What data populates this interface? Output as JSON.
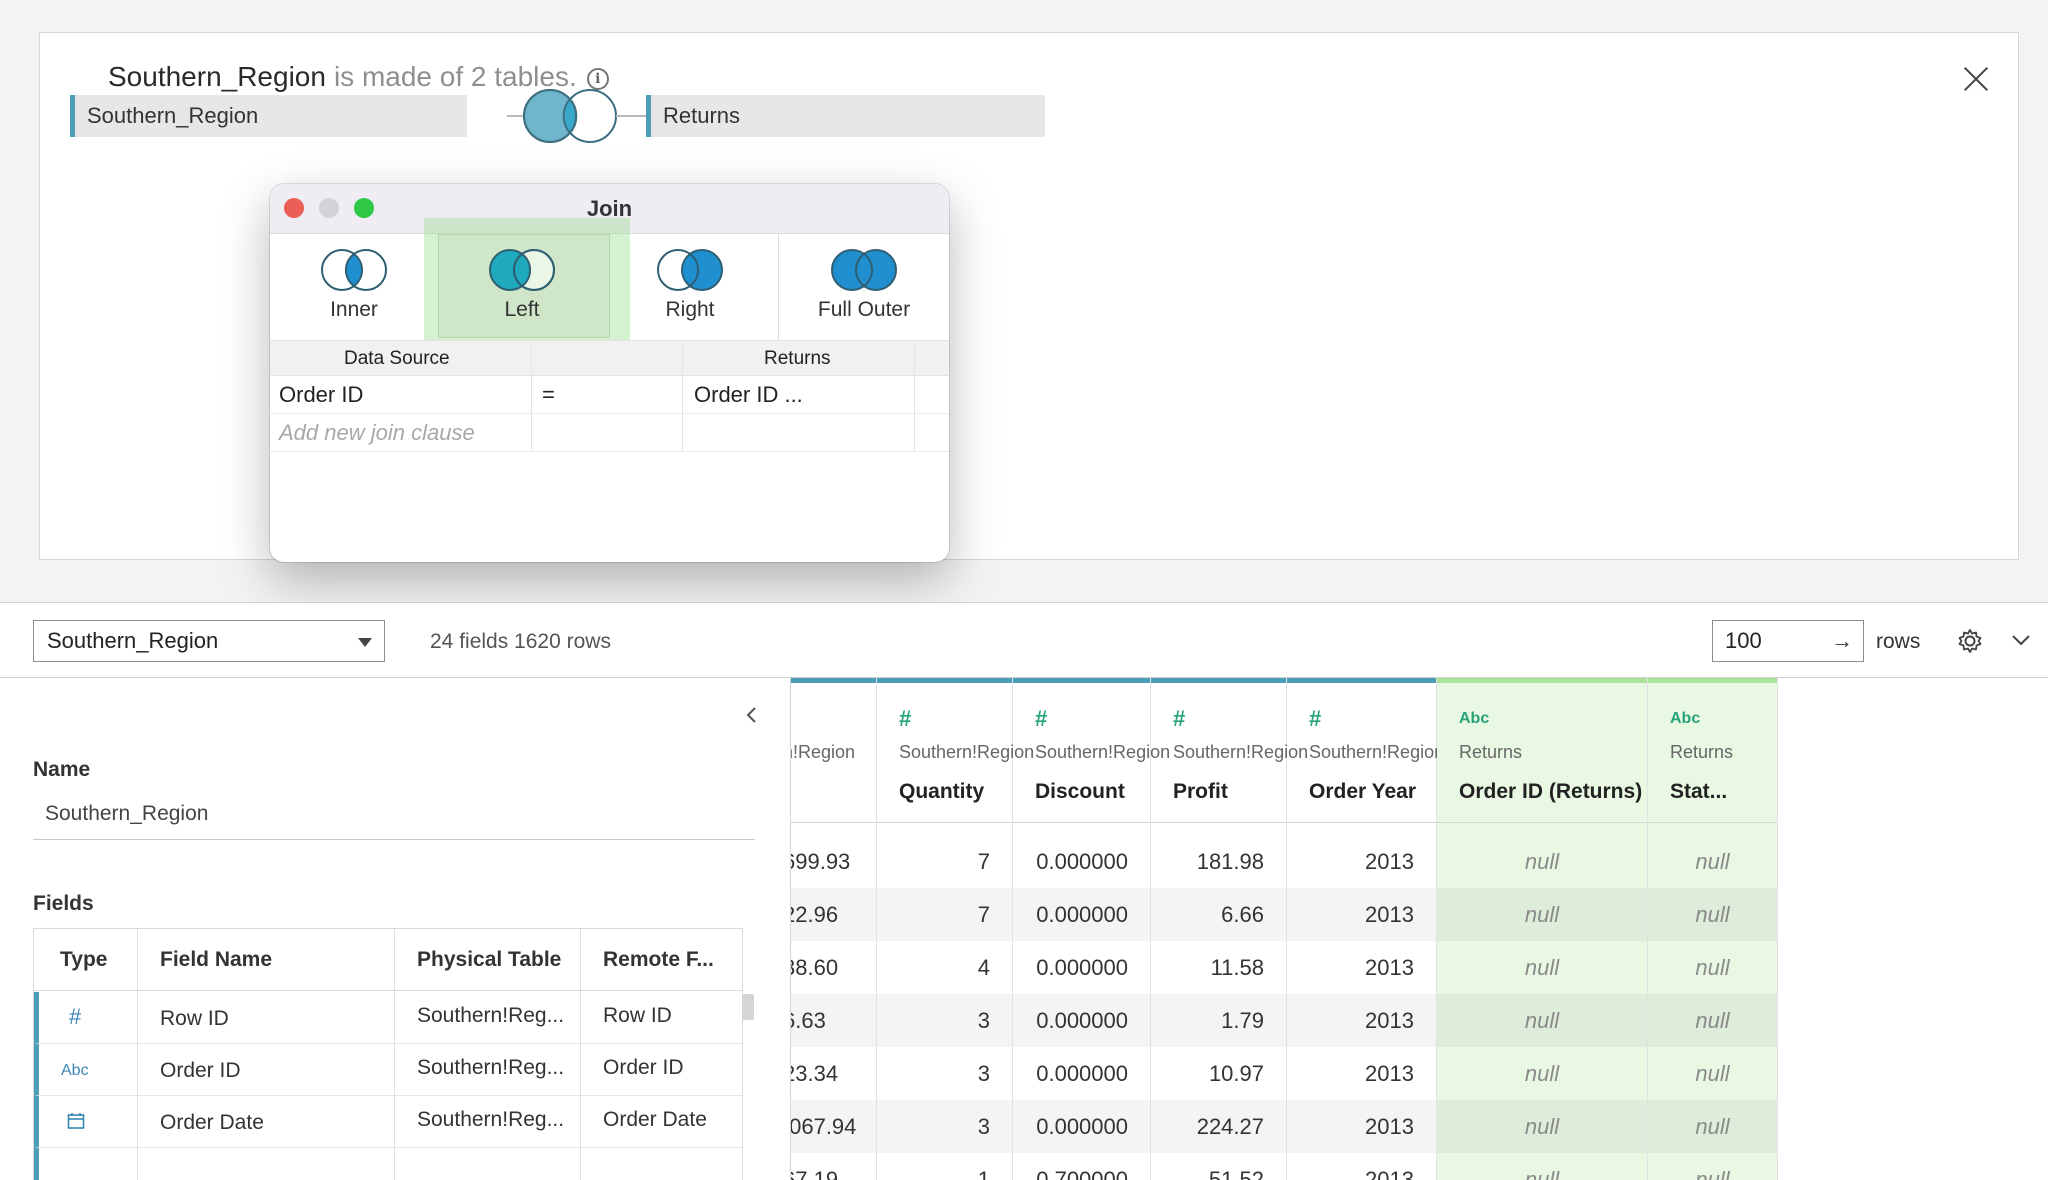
{
  "canvas": {
    "source_name": "Southern_Region",
    "source_subtitle": "is made of 2 tables.",
    "left_table": "Southern_Region",
    "right_table": "Returns"
  },
  "dialog": {
    "title": "Join",
    "types": [
      "Inner",
      "Left",
      "Right",
      "Full Outer"
    ],
    "selected_type": "Left",
    "headers": {
      "left": "Data Source",
      "right": "Returns"
    },
    "clause": {
      "left": "Order ID",
      "op": "=",
      "right": "Order ID ..."
    },
    "add_clause_placeholder": "Add new join clause"
  },
  "toolbar": {
    "source_select": "Southern_Region",
    "field_count": "24 fields 1620 rows",
    "rows_value": "100",
    "rows_arrow": "→",
    "rows_label": "rows"
  },
  "metadata": {
    "name_label": "Name",
    "name_value": "Southern_Region",
    "fields_label": "Fields",
    "columns": [
      "Type",
      "Field Name",
      "Physical Table",
      "Remote F..."
    ],
    "rows": [
      {
        "type_icon": "#",
        "field": "Row ID",
        "table": "Southern!Reg...",
        "remote": "Row ID"
      },
      {
        "type_icon": "Abc",
        "field": "Order ID",
        "table": "Southern!Reg...",
        "remote": "Order ID"
      },
      {
        "type_icon": "calendar-icon",
        "field": "Order Date",
        "table": "Southern!Reg...",
        "remote": "Order Date"
      }
    ]
  },
  "grid": {
    "columns": [
      {
        "type_icon": "",
        "source": "n!Region",
        "name": "",
        "values": [
          "699.93",
          "22.96",
          "38.60",
          "6.63",
          "23.34",
          ",067.94",
          "67.19"
        ]
      },
      {
        "type_icon": "#",
        "source": "Southern!Region",
        "name": "Quantity",
        "values": [
          "7",
          "7",
          "4",
          "3",
          "3",
          "3",
          "1"
        ]
      },
      {
        "type_icon": "#",
        "source": "Southern!Region",
        "name": "Discount",
        "values": [
          "0.000000",
          "0.000000",
          "0.000000",
          "0.000000",
          "0.000000",
          "0.000000",
          "0.700000"
        ]
      },
      {
        "type_icon": "#",
        "source": "Southern!Region",
        "name": "Profit",
        "values": [
          "181.98",
          "6.66",
          "11.58",
          "1.79",
          "10.97",
          "224.27",
          "-51.52"
        ]
      },
      {
        "type_icon": "#",
        "source": "Southern!Region",
        "name": "Order Year",
        "values": [
          "2013",
          "2013",
          "2013",
          "2013",
          "2013",
          "2013",
          "2013"
        ]
      },
      {
        "type_icon": "Abc",
        "source": "Returns",
        "name": "Order ID (Returns)",
        "values": [
          "null",
          "null",
          "null",
          "null",
          "null",
          "null",
          "null"
        ]
      },
      {
        "type_icon": "Abc",
        "source": "Returns",
        "name": "Stat...",
        "values": [
          "null",
          "null",
          "null",
          "null",
          "null",
          "null",
          "null"
        ]
      }
    ]
  },
  "colors": {
    "accent_blue": "#4c9db8",
    "venn_fill": "#3aa8c8",
    "selected_green": "#cfe6c9",
    "returns_column": "#e9f8e3",
    "type_icon_green": "#27a37a"
  }
}
